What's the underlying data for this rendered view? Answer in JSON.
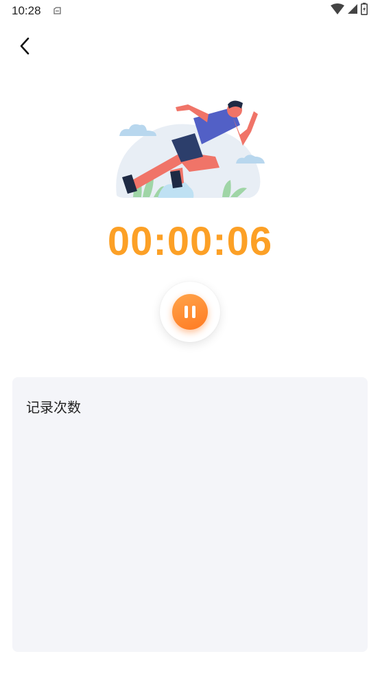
{
  "status_bar": {
    "time": "10:28",
    "icons": [
      "app-notification-icon",
      "wifi-icon",
      "signal-icon",
      "battery-icon"
    ]
  },
  "nav": {
    "back_icon": "chevron-left-icon"
  },
  "hero": {
    "illustration": "running-man-illustration"
  },
  "timer": {
    "value": "00:00:06",
    "color": "#fca026"
  },
  "controls": {
    "pause_icon": "pause-icon",
    "accent": "#ff8a2e"
  },
  "record": {
    "title": "记录次数"
  }
}
